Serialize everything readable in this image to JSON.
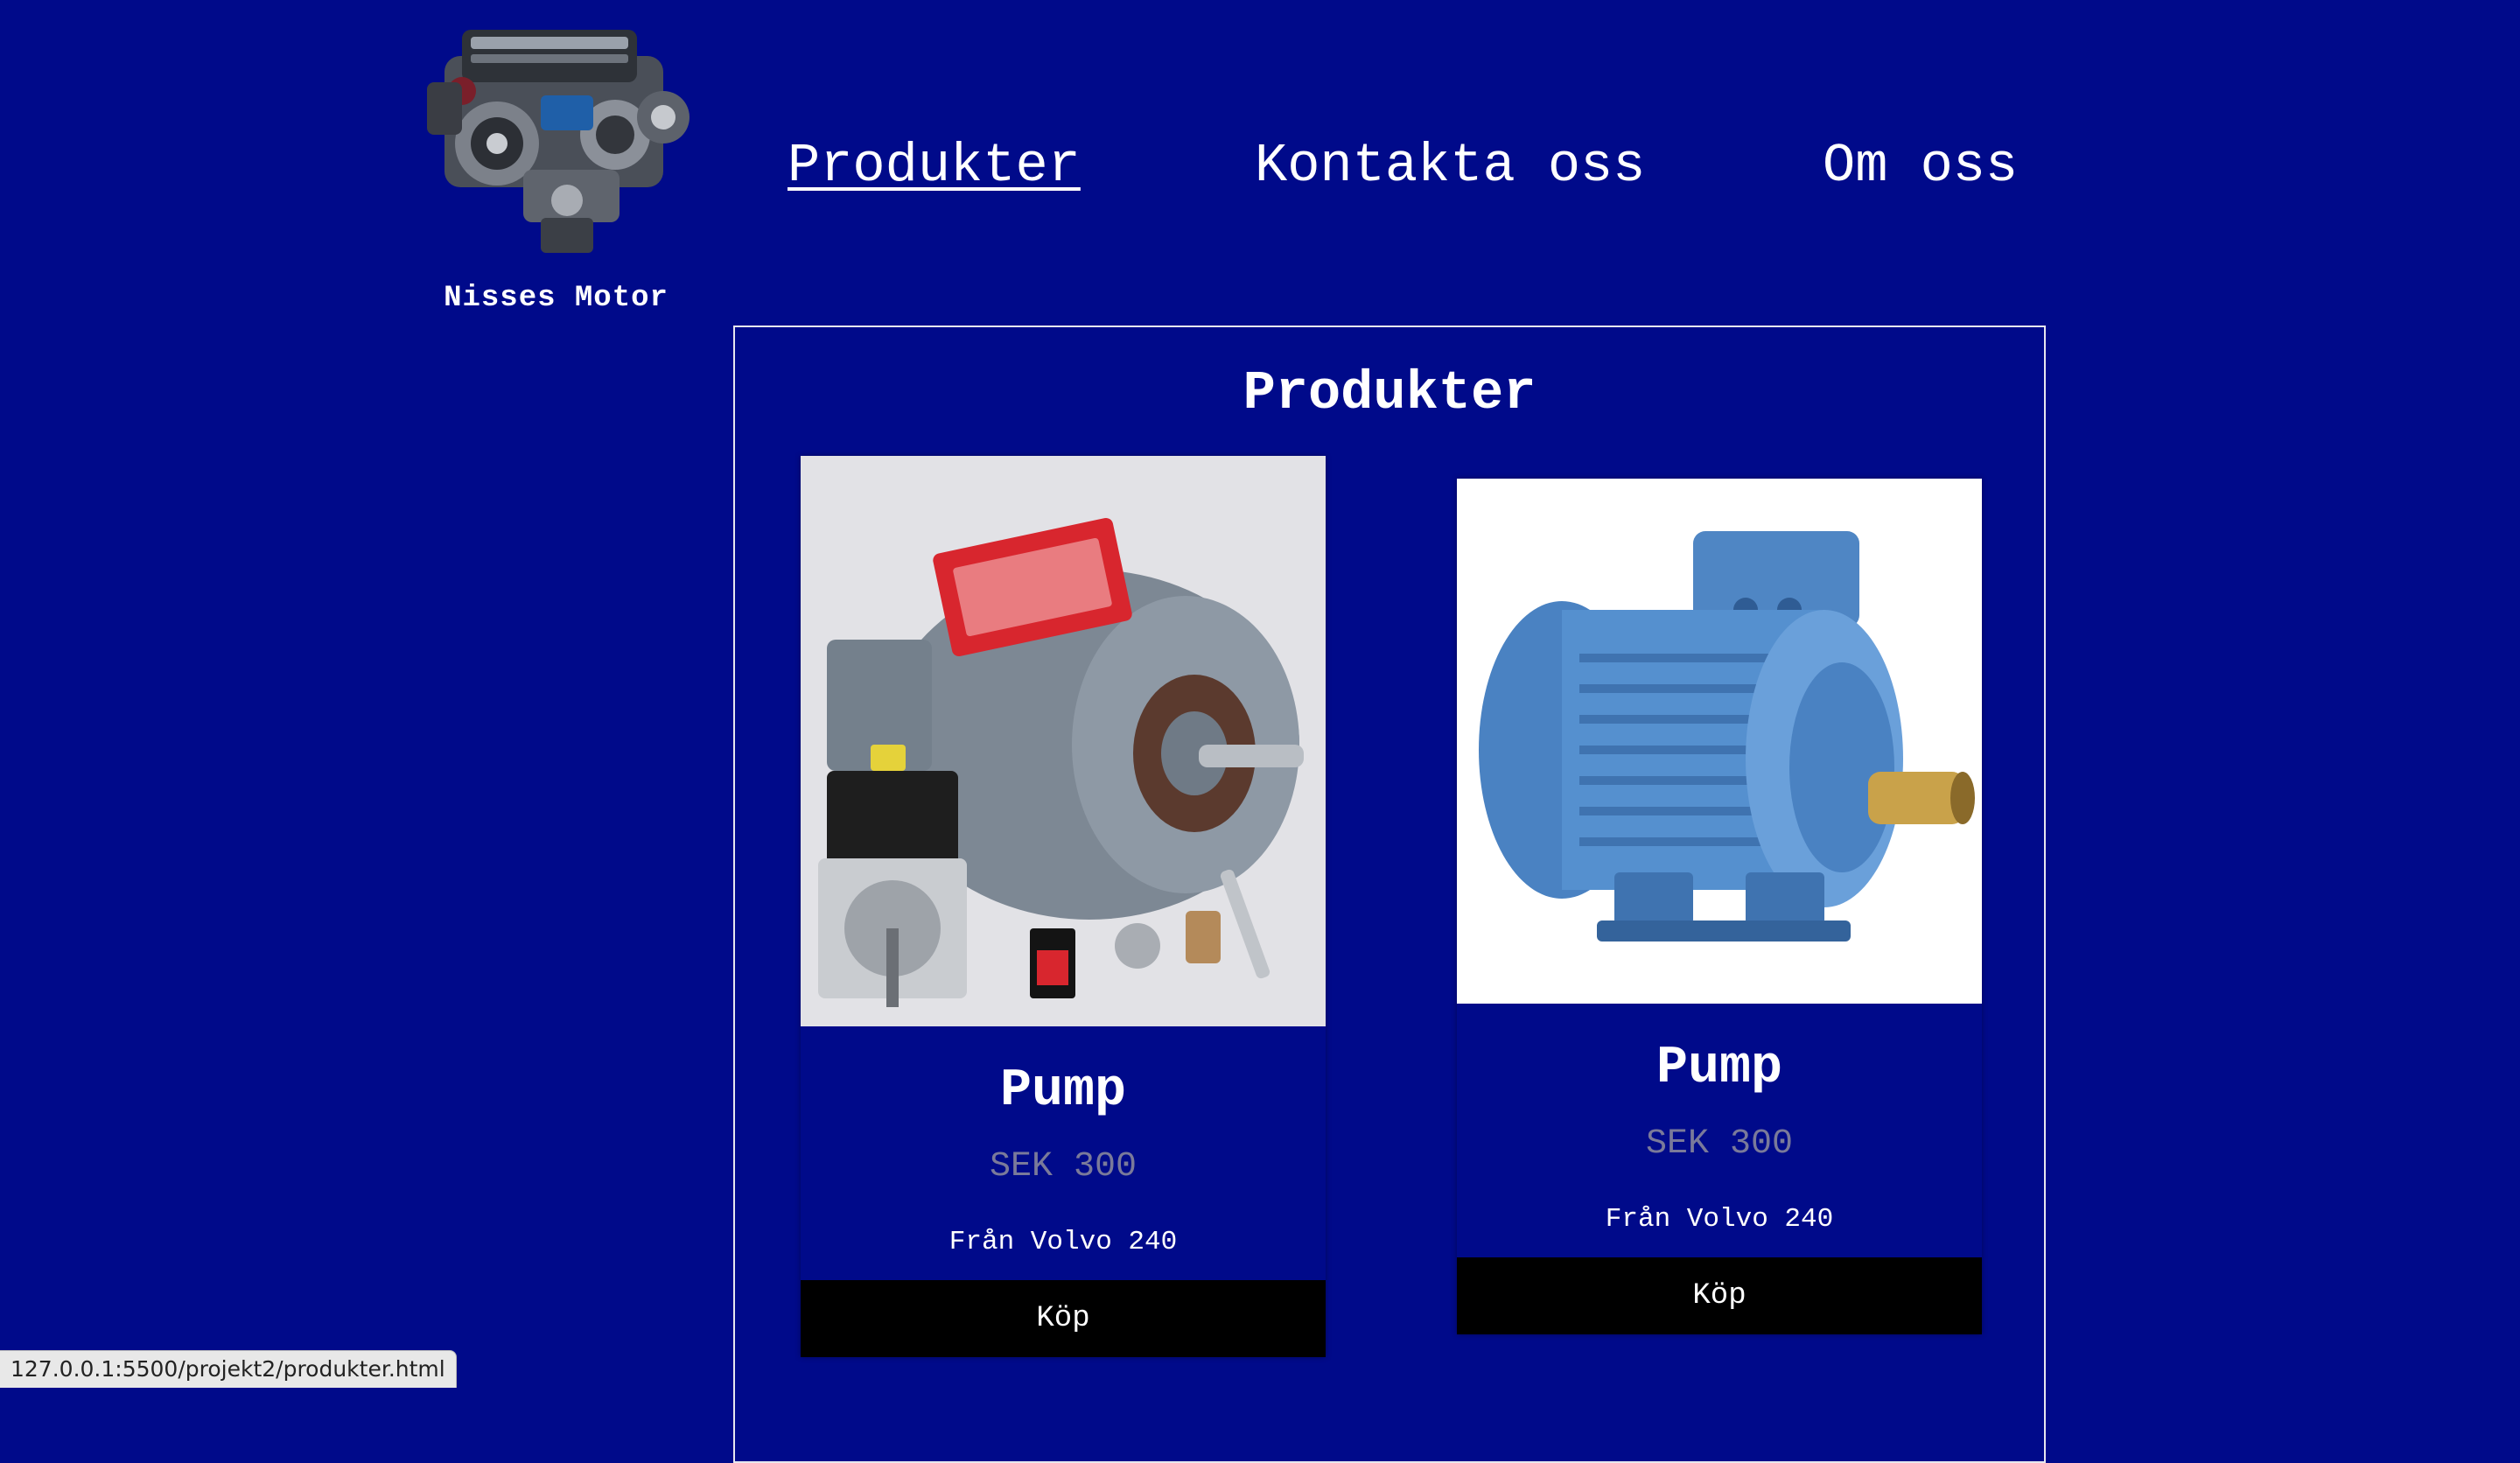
{
  "brand": {
    "name": "Nisses Motor",
    "logo_icon": "engine-logo-icon"
  },
  "nav": {
    "items": [
      {
        "label": "Produkter",
        "active": true
      },
      {
        "label": "Kontakta oss",
        "active": false
      },
      {
        "label": "Om oss",
        "active": false
      }
    ]
  },
  "main": {
    "title": "Produkter"
  },
  "products": [
    {
      "name": "Pump",
      "price": "SEK 300",
      "description": "Från Volvo 240",
      "buy_label": "Köp",
      "image_icon": "grey-electric-motor-photo"
    },
    {
      "name": "Pump",
      "price": "SEK 300",
      "description": "Från Volvo 240",
      "buy_label": "Köp",
      "image_icon": "blue-electric-motor-photo"
    }
  ],
  "status_bar": {
    "url": "127.0.0.1:5500/projekt2/produkter.html"
  },
  "colors": {
    "background": "#000a8a",
    "text": "#ffffff",
    "price": "#7a7a9a",
    "buy_button": "#000000"
  }
}
